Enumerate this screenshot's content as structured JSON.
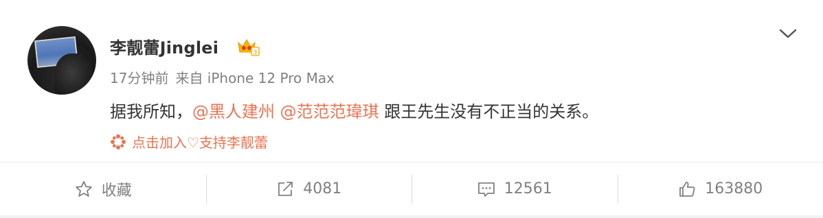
{
  "post": {
    "username": "李靓蕾Jinglei",
    "time": "17分钟前",
    "source": "来自 iPhone 12 Pro Max",
    "content": {
      "prefix": "据我所知，",
      "mention1": "@黑人建州",
      "mention2": "@范范范瑋琪",
      "suffix": " 跟王先生没有不正当的关系。"
    },
    "support_text": "点击加入♡支持李靓蕾"
  },
  "actions": {
    "favorite_label": "收藏",
    "repost_count": "4081",
    "comment_count": "12561",
    "like_count": "163880"
  },
  "icons": {
    "vip": "crown-badge-icon",
    "menu": "chevron-down-icon",
    "support": "flower-icon",
    "favorite": "star-icon",
    "repost": "share-icon",
    "comment": "comment-icon",
    "like": "thumbs-up-icon"
  },
  "colors": {
    "accent": "#eb7350",
    "muted": "#808080",
    "text": "#333333"
  }
}
